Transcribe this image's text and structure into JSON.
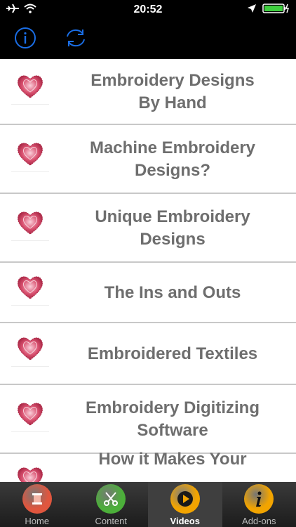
{
  "status": {
    "time": "20:52",
    "icons": [
      "airplane-icon",
      "wifi-icon",
      "location-icon",
      "battery-charging-icon"
    ]
  },
  "toolbar": {
    "info_icon": "info-icon",
    "refresh_icon": "refresh-icon",
    "accent": "#1a6ee6"
  },
  "list": {
    "rows": [
      {
        "line1": "Embroidery Designs",
        "line2": "By Hand"
      },
      {
        "line1": "Machine Embroidery",
        "line2": "Designs?"
      },
      {
        "line1": "Unique Embroidery",
        "line2": "Designs"
      },
      {
        "line1": "The Ins and Outs",
        "line2": ""
      },
      {
        "line1": "Embroidered Textiles",
        "line2": ""
      },
      {
        "line1": "Embroidery Digitizing",
        "line2": "Software"
      },
      {
        "line1": "How it Makes Your",
        "line2": ""
      }
    ],
    "thumbnail_icon": "heart-icon",
    "text_color": "#6e6e6e"
  },
  "tabs": [
    {
      "label": "Home",
      "icon": "home-spool-icon",
      "color": "#e0563e",
      "active": false
    },
    {
      "label": "Content",
      "icon": "scissors-icon",
      "color": "#4caf3a",
      "active": false
    },
    {
      "label": "Videos",
      "icon": "play-icon",
      "color": "#f2a400",
      "active": true
    },
    {
      "label": "Add-ons",
      "icon": "info-icon",
      "color": "#f2a400",
      "active": false
    }
  ]
}
